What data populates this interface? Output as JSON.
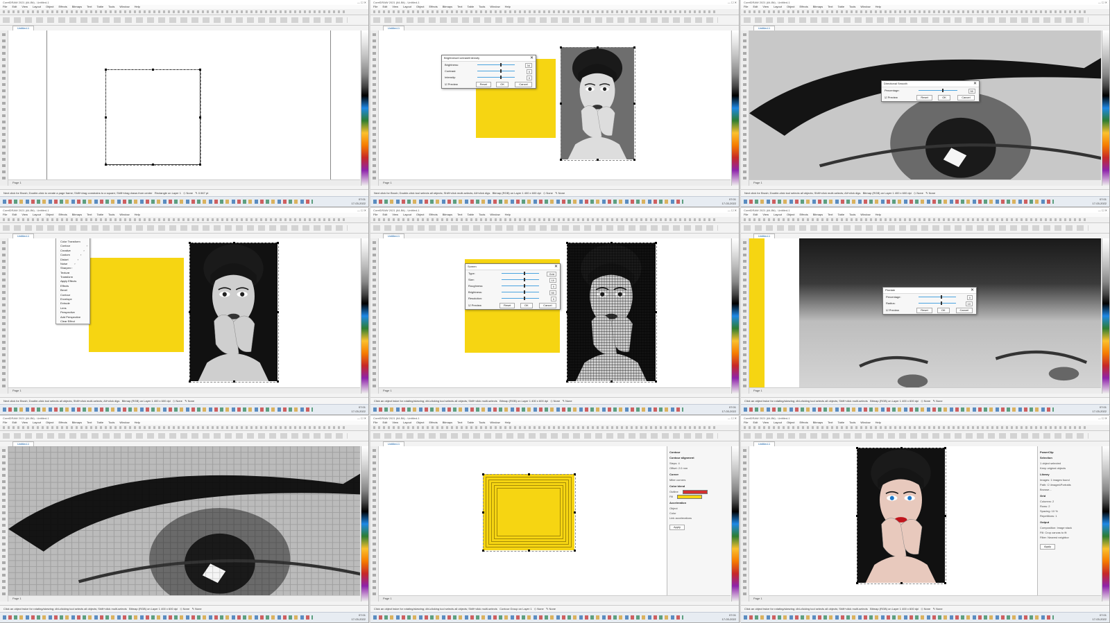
{
  "app": {
    "window_title": "CorelDRAW 2021 (64-Bit) - Untitled-1",
    "menu": [
      "File",
      "Edit",
      "View",
      "Layout",
      "Object",
      "Effects",
      "Bitmaps",
      "Text",
      "Table",
      "Tools",
      "Window",
      "Help"
    ],
    "doc_tab": "Untitled-1",
    "page_tab": "Page 1",
    "taskbar_time": "07:01",
    "taskbar_date": "17-03-2022"
  },
  "panels": [
    {
      "id": "p1",
      "status": "Next click for Brush; Double-click to create a page frame; Shift+drag constrains to a square; Shift+drag draws from center",
      "object": "Rectangle on Layer 1",
      "fill": "None",
      "outline": "0.567 pt"
    },
    {
      "id": "p2",
      "status": "Next click for Brush; Double-click tool selects all objects; Shift+click multi-selects; Alt+click digs",
      "object": "Bitmap (RGB) on Layer 1 400 x 600 dpi",
      "fill": "None",
      "outline": "None",
      "dialog": {
        "title": "Brightness/Contrast/Intensity",
        "rows": [
          {
            "label": "Brightness:",
            "value": "34"
          },
          {
            "label": "Contrast:",
            "value": "0"
          },
          {
            "label": "Intensity:",
            "value": "0"
          }
        ],
        "preview": "Preview",
        "buttons": [
          "Reset",
          "OK",
          "Cancel"
        ]
      }
    },
    {
      "id": "p3",
      "status": "Next click for Brush; Double-click tool selects all objects; Shift+click multi-selects; Alt+click digs",
      "object": "Bitmap (RGB) on Layer 1 400 x 600 dpi",
      "fill": "None",
      "outline": "None",
      "dialog": {
        "title": "Directional Smooth",
        "rows": [
          {
            "label": "Percentage:",
            "value": "50"
          }
        ],
        "preview": "Preview",
        "buttons": [
          "Reset",
          "OK",
          "Cancel"
        ]
      }
    },
    {
      "id": "p4",
      "status": "Next click for Brush; Double-click tool selects all objects; Shift+click multi-selects; Alt+click digs",
      "object": "Bitmap (RGB) on Layer 1 400 x 600 dpi",
      "fill": "None",
      "outline": "None",
      "menu": [
        "Distort Effects",
        "Adjust",
        "Art Strokes",
        "Blur",
        "Camera",
        "Color Transform",
        "Contour",
        "Creative",
        "Custom",
        "Distort",
        "Noise",
        "Sharpen",
        "Texture",
        "Transform",
        "Apply Effects",
        "Effects",
        "Bevel",
        "Contour",
        "Envelope",
        "Extrude",
        "Lens",
        "Perspective",
        "Add Perspective",
        "Clear Effect"
      ]
    },
    {
      "id": "p5",
      "status": "Click an object twice for rotating/skewing; dbl-clicking tool selects all objects; Shift+click multi-selects",
      "object": "Bitmap (RGB) on Layer 1 400 x 600 dpi",
      "fill": "None",
      "outline": "None",
      "dialog": {
        "title": "Screen",
        "rows": [
          {
            "label": "Type:",
            "value": "Grid"
          },
          {
            "label": "Size:",
            "value": "10"
          },
          {
            "label": "Roughness:",
            "value": "0"
          },
          {
            "label": "Brightness:",
            "value": "50"
          },
          {
            "label": "Resolution:",
            "value": "0"
          }
        ],
        "preview": "Preview",
        "buttons": [
          "Reset",
          "OK",
          "Cancel"
        ]
      }
    },
    {
      "id": "p6",
      "status": "Click an object twice for rotating/skewing; dbl-clicking tool selects all objects; Shift+click multi-selects",
      "object": "Bitmap (RGB) on Layer 1 400 x 600 dpi",
      "fill": "None",
      "outline": "None",
      "dialog": {
        "title": "Pixelate",
        "rows": [
          {
            "label": "Percentage:",
            "value": "0"
          },
          {
            "label": "Radius:",
            "value": "10"
          }
        ],
        "preview": "Preview",
        "buttons": [
          "Reset",
          "OK",
          "Cancel"
        ]
      }
    },
    {
      "id": "p7",
      "status": "Click an object twice for rotating/skewing; dbl-clicking tool selects all objects; Shift+click multi-selects",
      "object": "Bitmap (RGB) on Layer 1 400 x 600 dpi",
      "fill": "None",
      "outline": "None"
    },
    {
      "id": "p8",
      "status": "Click an object twice for rotating/skewing; dbl-clicking tool selects all objects; Shift+click multi-selects",
      "object": "Contour Group on Layer 1",
      "fill": "None",
      "outline": "None",
      "docker": {
        "title": "Contour",
        "sections": [
          {
            "heading": "Contour alignment",
            "rows": [
              "Steps: 4",
              "Offset: 2.0 mm"
            ]
          },
          {
            "heading": "Corner",
            "rows": [
              "Miter corners"
            ]
          },
          {
            "heading": "Color blend",
            "rows": [
              "Outline",
              "Fill"
            ]
          },
          {
            "heading": "Acceleration",
            "rows": [
              "Object",
              "Color",
              "Link accelerations"
            ]
          }
        ],
        "apply": "Apply",
        "outline_color": "#d32f2f",
        "fill_color": "#f6d512"
      }
    },
    {
      "id": "p9",
      "status": "Click an object twice for rotating/skewing; dbl-clicking tool selects all objects; Shift+click multi-selects",
      "object": "Bitmap (RGB) on Layer 1 400 x 600 dpi",
      "fill": "None",
      "outline": "None",
      "docker": {
        "title": "PowerClip",
        "sections": [
          {
            "heading": "Selection",
            "rows": [
              "1 object selected",
              "Keep original objects"
            ]
          },
          {
            "heading": "Library",
            "rows": [
              "Images: 1 images found",
              "Path: C:\\Images\\Portraits",
              "Browse..."
            ]
          },
          {
            "heading": "Grid",
            "rows": [
              "Columns: 2",
              "Rows: 2",
              "Spacing: 10 %",
              "Repetitions: 1"
            ]
          },
          {
            "heading": "Output",
            "rows": [
              "Composition: Image stack",
              "Fill: Crop canvas to fit",
              "Filter: Nearest neighbor"
            ]
          }
        ],
        "apply": "Apply"
      }
    }
  ]
}
